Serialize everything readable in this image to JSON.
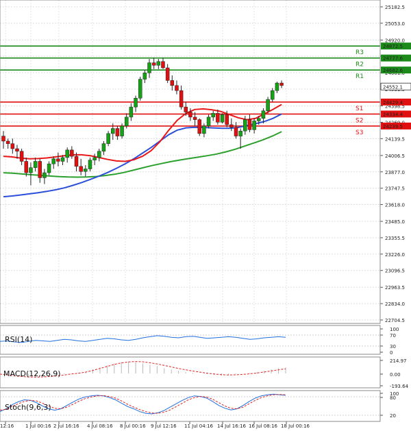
{
  "chart_data": {
    "type": "candlestick",
    "price_axis": {
      "ticks": [
        25182.5,
        25053.0,
        24920.0,
        24791.5,
        24661.0,
        24531.5,
        24398.5,
        24269.0,
        24139.5,
        24006.5,
        23877.0,
        23747.5,
        23618.0,
        23485.0,
        23355.5,
        23226.0,
        23096.5,
        22963.5,
        22834.0,
        22704.5
      ],
      "ylim": [
        22704.5,
        25182.5
      ]
    },
    "time_axis": {
      "labels": [
        "12:16",
        "1 Jul 00:16",
        "2 Jul 16:16",
        "4 Jul 08:16",
        "8 Jul 00:16",
        "9 Jul 12:16",
        "11 Jul 04:16",
        "14 Jul 16:16",
        "16 Jul 08:16",
        "18 Jul 00:16"
      ],
      "n_bars": 80
    },
    "levels": [
      {
        "name": "R3",
        "value": 24872.5,
        "color": "#1b8a1b"
      },
      {
        "name": "R2",
        "value": 24777.6,
        "color": "#1b8a1b"
      },
      {
        "name": "R1",
        "value": 24682.6,
        "color": "#1b8a1b"
      },
      {
        "name": "S1",
        "value": 24429.4,
        "color": "#e01010"
      },
      {
        "name": "S2",
        "value": 24334.4,
        "color": "#e01010"
      },
      {
        "name": "S3",
        "value": 24239.5,
        "color": "#e01010"
      }
    ],
    "last_price": "24552.1",
    "candles": [
      [
        24160,
        24200,
        24060,
        24120
      ],
      [
        24120,
        24140,
        24060,
        24100
      ],
      [
        24100,
        24140,
        24020,
        24060
      ],
      [
        24060,
        24090,
        23980,
        24040
      ],
      [
        24040,
        24060,
        23930,
        23960
      ],
      [
        23960,
        23990,
        23840,
        23870
      ],
      [
        23870,
        23950,
        23770,
        23910
      ],
      [
        23910,
        23990,
        23880,
        23960
      ],
      [
        23960,
        23980,
        23790,
        23830
      ],
      [
        23830,
        23900,
        23780,
        23870
      ],
      [
        23870,
        23960,
        23850,
        23940
      ],
      [
        23940,
        24000,
        23900,
        23980
      ],
      [
        23980,
        24030,
        23920,
        23960
      ],
      [
        23960,
        24010,
        23930,
        23990
      ],
      [
        23990,
        24070,
        23950,
        24050
      ],
      [
        24050,
        24080,
        23980,
        24000
      ],
      [
        24000,
        24030,
        23880,
        23920
      ],
      [
        23920,
        23980,
        23850,
        23880
      ],
      [
        23880,
        23930,
        23840,
        23900
      ],
      [
        23900,
        23990,
        23880,
        23970
      ],
      [
        23970,
        24020,
        23930,
        23990
      ],
      [
        23990,
        24060,
        23960,
        24040
      ],
      [
        24040,
        24120,
        24010,
        24100
      ],
      [
        24100,
        24200,
        24080,
        24180
      ],
      [
        24180,
        24260,
        24130,
        24220
      ],
      [
        24220,
        24240,
        24130,
        24160
      ],
      [
        24160,
        24260,
        24140,
        24240
      ],
      [
        24240,
        24340,
        24220,
        24310
      ],
      [
        24310,
        24420,
        24280,
        24390
      ],
      [
        24390,
        24480,
        24350,
        24460
      ],
      [
        24460,
        24630,
        24440,
        24610
      ],
      [
        24610,
        24680,
        24580,
        24660
      ],
      [
        24660,
        24770,
        24620,
        24740
      ],
      [
        24740,
        24780,
        24690,
        24720
      ],
      [
        24720,
        24770,
        24690,
        24750
      ],
      [
        24750,
        24780,
        24690,
        24700
      ],
      [
        24700,
        24730,
        24580,
        24600
      ],
      [
        24600,
        24640,
        24520,
        24560
      ],
      [
        24560,
        24600,
        24490,
        24520
      ],
      [
        24520,
        24560,
        24370,
        24390
      ],
      [
        24390,
        24430,
        24320,
        24350
      ],
      [
        24350,
        24380,
        24280,
        24310
      ],
      [
        24310,
        24350,
        24240,
        24290
      ],
      [
        24290,
        24300,
        24160,
        24180
      ],
      [
        24180,
        24260,
        24150,
        24240
      ],
      [
        24240,
        24330,
        24220,
        24310
      ],
      [
        24310,
        24360,
        24280,
        24340
      ],
      [
        24340,
        24370,
        24250,
        24270
      ],
      [
        24270,
        24340,
        24260,
        24330
      ],
      [
        24330,
        24360,
        24230,
        24250
      ],
      [
        24250,
        24300,
        24200,
        24230
      ],
      [
        24230,
        24270,
        24140,
        24160
      ],
      [
        24160,
        24220,
        24060,
        24200
      ],
      [
        24200,
        24320,
        24170,
        24290
      ],
      [
        24290,
        24330,
        24190,
        24210
      ],
      [
        24210,
        24300,
        24180,
        24280
      ],
      [
        24280,
        24320,
        24250,
        24300
      ],
      [
        24300,
        24380,
        24260,
        24360
      ],
      [
        24360,
        24470,
        24340,
        24450
      ],
      [
        24450,
        24540,
        24430,
        24520
      ],
      [
        24520,
        24590,
        24500,
        24580
      ],
      [
        24580,
        24600,
        24540,
        24560
      ]
    ],
    "ma_red": [
      24000,
      23995,
      23985,
      23980,
      23982,
      23987,
      23995,
      24005,
      24012,
      24012,
      24004,
      23990,
      23975,
      23963,
      23960,
      23972,
      24000,
      24045,
      24115,
      24205,
      24285,
      24340,
      24370,
      24375,
      24368,
      24355,
      24330,
      24305,
      24290,
      24300,
      24335,
      24370,
      24410
    ],
    "ma_blue": [
      23680,
      23686,
      23694,
      23703,
      23712,
      23722,
      23735,
      23750,
      23770,
      23792,
      23817,
      23843,
      23872,
      23905,
      23940,
      23980,
      24025,
      24070,
      24120,
      24170,
      24207,
      24225,
      24230,
      24228,
      24225,
      24222,
      24221,
      24228,
      24243,
      24258,
      24275,
      24300,
      24335
    ],
    "ma_green": [
      23870,
      23866,
      23860,
      23854,
      23849,
      23844,
      23839,
      23836,
      23835,
      23836,
      23840,
      23848,
      23858,
      23872,
      23890,
      23908,
      23926,
      23942,
      23957,
      23970,
      23982,
      23993,
      24005,
      24018,
      24035,
      24056,
      24080,
      24105,
      24130,
      24160,
      24195
    ],
    "rsi": {
      "label": "RSI(14)",
      "ticks": [
        "100",
        "70",
        "30",
        "0"
      ],
      "values": [
        44,
        46,
        42,
        40,
        44,
        48,
        46,
        44,
        48,
        52,
        50,
        46,
        44,
        48,
        52,
        56,
        54,
        50,
        48,
        52,
        58,
        62,
        66,
        64,
        60,
        58,
        62,
        64,
        60,
        56,
        58,
        60,
        62,
        60,
        56,
        52,
        54,
        58,
        60,
        62,
        60
      ]
    },
    "macd": {
      "label": "MACD(12,26,9)",
      "ticks": [
        "214.97",
        "0.00",
        "-193.64"
      ],
      "hist": [
        -20,
        -30,
        -40,
        -45,
        -50,
        -45,
        -40,
        -30,
        -20,
        -10,
        0,
        10,
        30,
        60,
        90,
        120,
        150,
        170,
        180,
        170,
        150,
        130,
        110,
        80,
        60,
        40,
        20,
        10,
        0,
        -10,
        -20,
        -30,
        -20,
        -10,
        0,
        10,
        20,
        40,
        60,
        80,
        90
      ],
      "signal": [
        -10,
        -20,
        -35,
        -45,
        -52,
        -55,
        -52,
        -45,
        -35,
        -22,
        -8,
        5,
        20,
        45,
        75,
        105,
        135,
        158,
        172,
        178,
        174,
        160,
        142,
        120,
        97,
        75,
        55,
        36,
        20,
        5,
        -8,
        -18,
        -22,
        -20,
        -14,
        -5,
        8,
        22,
        38,
        55,
        70
      ]
    },
    "stoch": {
      "label": "Stoch(9,6,3)",
      "ticks": [
        "100",
        "80",
        "20"
      ],
      "k": [
        30,
        40,
        55,
        65,
        72,
        70,
        62,
        50,
        40,
        35,
        40,
        52,
        64,
        75,
        82,
        86,
        88,
        86,
        80,
        72,
        60,
        48,
        40,
        30,
        24,
        22,
        26,
        34,
        46,
        58,
        70,
        80,
        86,
        84,
        78,
        66,
        52,
        42,
        36,
        40,
        52,
        66,
        78,
        86,
        90,
        92,
        90,
        88
      ],
      "d": [
        35,
        38,
        48,
        58,
        66,
        70,
        68,
        60,
        50,
        42,
        40,
        46,
        56,
        67,
        76,
        82,
        86,
        87,
        84,
        78,
        68,
        56,
        46,
        37,
        30,
        25,
        24,
        28,
        36,
        48,
        60,
        72,
        80,
        84,
        82,
        74,
        62,
        50,
        42,
        40,
        46,
        58,
        70,
        80,
        86,
        90,
        91,
        90
      ]
    }
  }
}
